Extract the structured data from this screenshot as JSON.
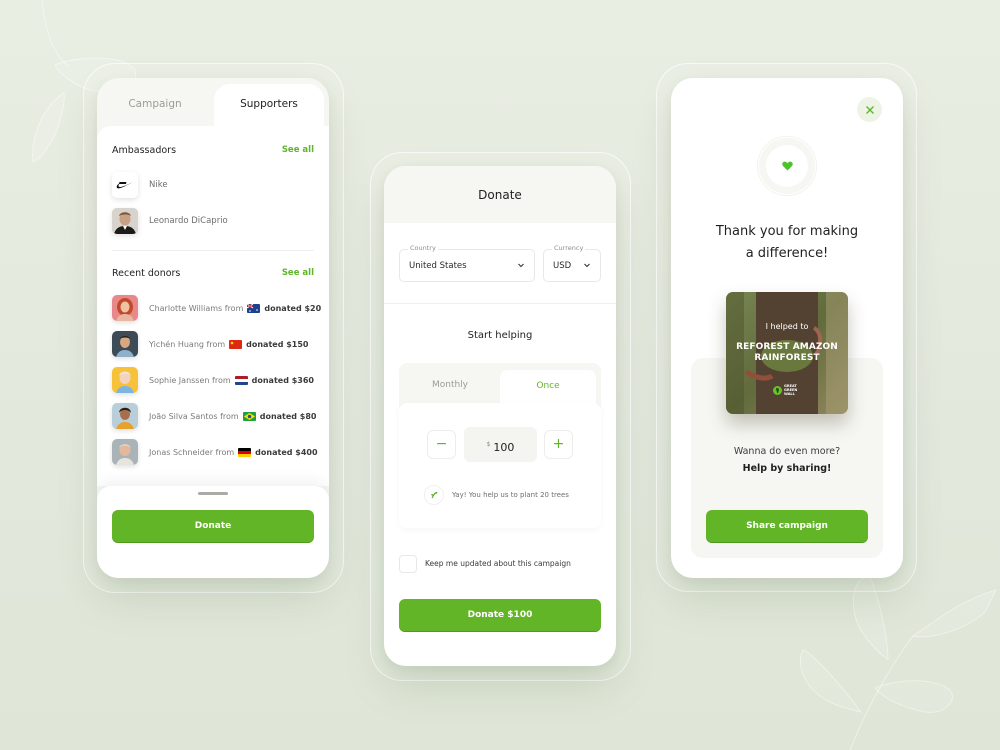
{
  "colors": {
    "accent": "#62b526",
    "background": "#e6ebe0",
    "card": "#ffffff",
    "muted_text": "#9a9d97"
  },
  "supporters_screen": {
    "tabs": [
      {
        "label": "Campaign",
        "active": false
      },
      {
        "label": "Supporters",
        "active": true
      }
    ],
    "ambassadors": {
      "title": "Ambassadors",
      "see_all": "See all",
      "items": [
        {
          "name": "Nike",
          "icon": "nike-logo"
        },
        {
          "name": "Leonardo DiCaprio",
          "icon": "avatar-photo"
        }
      ]
    },
    "recent_donors": {
      "title": "Recent donors",
      "see_all": "See all",
      "items": [
        {
          "name": "Charlotte Williams",
          "from": "from",
          "country_flag": "australia-flag",
          "amount": "donated $20"
        },
        {
          "name": "Yichén Huang",
          "from": "from",
          "country_flag": "china-flag",
          "amount": "donated $150"
        },
        {
          "name": "Sophie Janssen",
          "from": "from",
          "country_flag": "netherlands-flag",
          "amount": "donated $360"
        },
        {
          "name": "João Silva Santos",
          "from": "from",
          "country_flag": "brazil-flag",
          "amount": "donated $80"
        },
        {
          "name": "Jonas Schneider",
          "from": "from",
          "country_flag": "germany-flag",
          "amount": "donated $400"
        }
      ]
    },
    "donate_button": "Donate"
  },
  "donate_screen": {
    "title": "Donate",
    "country": {
      "label": "Country",
      "value": "United States"
    },
    "currency": {
      "label": "Currency",
      "value": "USD"
    },
    "start_helping": "Start helping",
    "frequency_tabs": [
      {
        "label": "Monthly",
        "active": false
      },
      {
        "label": "Once",
        "active": true
      }
    ],
    "amount": {
      "currency_symbol": "$",
      "value": "100",
      "minus": "−",
      "plus": "+"
    },
    "tree_note": "Yay! You help us to plant 20 trees",
    "keep_updated": {
      "label": "Keep me updated about this campaign",
      "checked": false
    },
    "donate_button": "Donate $100"
  },
  "thank_you_screen": {
    "close_icon": "close-icon",
    "heart_icon": "green-heart-icon",
    "title_line1": "Thank you for making",
    "title_line2": "a difference!",
    "campaign_image": {
      "line1": "I helped to",
      "line2": "REFOREST AMAZON",
      "line3": "RAINFOREST",
      "logo_text": [
        "GREAT",
        "GREEN",
        "WALL"
      ]
    },
    "wanna": "Wanna do even more?",
    "help_share": "Help by sharing!",
    "share_button": "Share campaign"
  }
}
